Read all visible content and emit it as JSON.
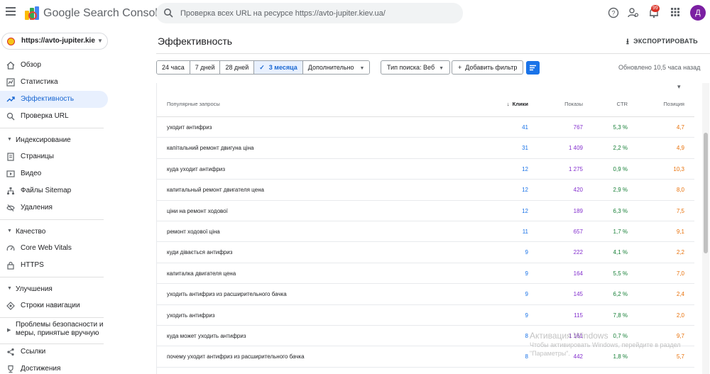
{
  "app": {
    "title": "Google Search Console",
    "search_placeholder": "Проверка всех URL на ресурсе https://avto-jupiter.kiev.ua/",
    "notification_count": "99",
    "avatar_letter": "Д"
  },
  "sidebar": {
    "property": "https://avto-jupiter.kiev.ua/",
    "items": {
      "overview": "Обзор",
      "stats": "Статистика",
      "performance": "Эффективность",
      "url_check": "Проверка URL",
      "indexing": "Индексирование",
      "pages": "Страницы",
      "video": "Видео",
      "sitemaps": "Файлы Sitemap",
      "removals": "Удаления",
      "quality": "Качество",
      "cwv": "Core Web Vitals",
      "https": "HTTPS",
      "enhancements": "Улучшения",
      "breadcrumbs": "Строки навигации",
      "security": "Проблемы безопасности и меры, принятые вручную",
      "links": "Ссылки",
      "achievements": "Достижения"
    }
  },
  "main": {
    "title": "Эффективность",
    "export_label": "ЭКСПОРТИРОВАТЬ",
    "date_chips": [
      "24 часа",
      "7 дней",
      "28 дней",
      "3 месяца",
      "Дополнительно"
    ],
    "selected_chip_index": 3,
    "search_type": "Тип поиска: Веб",
    "add_filter": "Добавить фильтр",
    "updated": "Обновлено 10,5 часа назад",
    "accent": "#1a73e8"
  },
  "table": {
    "headers": {
      "query": "Популярные запросы",
      "clicks": "Клики",
      "impressions": "Показы",
      "ctr": "CTR",
      "position": "Позиция"
    },
    "rows": [
      {
        "query": "уходит антифриз",
        "clicks": "41",
        "impressions": "767",
        "ctr": "5,3 %",
        "position": "4,7"
      },
      {
        "query": "капітальний ремонт двигуна ціна",
        "clicks": "31",
        "impressions": "1 409",
        "ctr": "2,2 %",
        "position": "4,9"
      },
      {
        "query": "куда уходит антифриз",
        "clicks": "12",
        "impressions": "1 275",
        "ctr": "0,9 %",
        "position": "10,3"
      },
      {
        "query": "капитальный ремонт двигателя цена",
        "clicks": "12",
        "impressions": "420",
        "ctr": "2,9 %",
        "position": "8,0"
      },
      {
        "query": "ціни на ремонт ходової",
        "clicks": "12",
        "impressions": "189",
        "ctr": "6,3 %",
        "position": "7,5"
      },
      {
        "query": "ремонт ходової ціна",
        "clicks": "11",
        "impressions": "657",
        "ctr": "1,7 %",
        "position": "9,1"
      },
      {
        "query": "куди дівається антифриз",
        "clicks": "9",
        "impressions": "222",
        "ctr": "4,1 %",
        "position": "2,2"
      },
      {
        "query": "капиталка двигателя цена",
        "clicks": "9",
        "impressions": "164",
        "ctr": "5,5 %",
        "position": "7,0"
      },
      {
        "query": "уходить антифриз из расширительного бачка",
        "clicks": "9",
        "impressions": "145",
        "ctr": "6,2 %",
        "position": "2,4"
      },
      {
        "query": "уходить антифриз",
        "clicks": "9",
        "impressions": "115",
        "ctr": "7,8 %",
        "position": "2,0"
      },
      {
        "query": "куда может уходить антифриз",
        "clicks": "8",
        "impressions": "1 161",
        "ctr": "0,7 %",
        "position": "9,7"
      },
      {
        "query": "почему уходит антифриз из расширительного бачка",
        "clicks": "8",
        "impressions": "442",
        "ctr": "1,8 %",
        "position": "5,7"
      }
    ]
  },
  "watermark": {
    "line1": "Активация Windows",
    "line2": "Чтобы активировать Windows, перейдите в раздел \"Параметры\"."
  }
}
